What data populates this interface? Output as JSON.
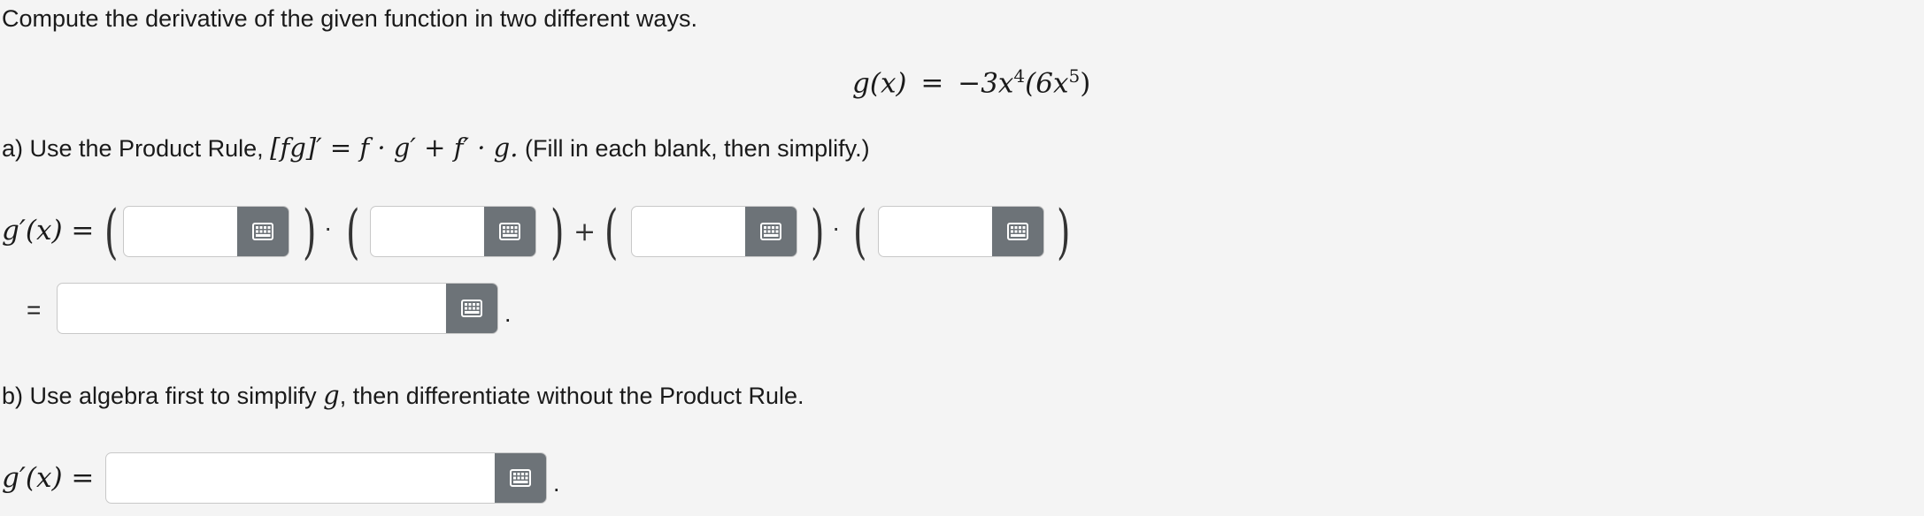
{
  "instruction": "Compute the derivative of the given function in two different ways.",
  "given": {
    "lhs": "g(x)",
    "equals": "=",
    "rhs": "−3x",
    "exp1": "4",
    "rhs2": "(6x",
    "exp2": "5",
    "rhs3": ")"
  },
  "part_a": {
    "label_prefix": "a) Use the Product Rule,",
    "formula": "[fg]′ = f · g′ + f′ · g.",
    "label_suffix": "(Fill in each blank, then simplify.)",
    "lhs": "g′(x) =",
    "plus": "+",
    "times": "·",
    "open_paren": "(",
    "close_paren": ")",
    "equals": "=",
    "period": "."
  },
  "part_b": {
    "label_prefix": "b) Use algebra first to simplify",
    "var": "g",
    "label_suffix": ", then differentiate without the Product Rule.",
    "lhs": "g′(x) =",
    "period": "."
  },
  "inputs": {
    "a1": "",
    "a2": "",
    "a3": "",
    "a4": "",
    "a_simplified": "",
    "b_answer": ""
  },
  "icons": {
    "keypad": "keypad-icon"
  },
  "colors": {
    "background": "#f4f4f4",
    "keypad_button": "#6d7378",
    "field_border": "#c8c8c8"
  }
}
